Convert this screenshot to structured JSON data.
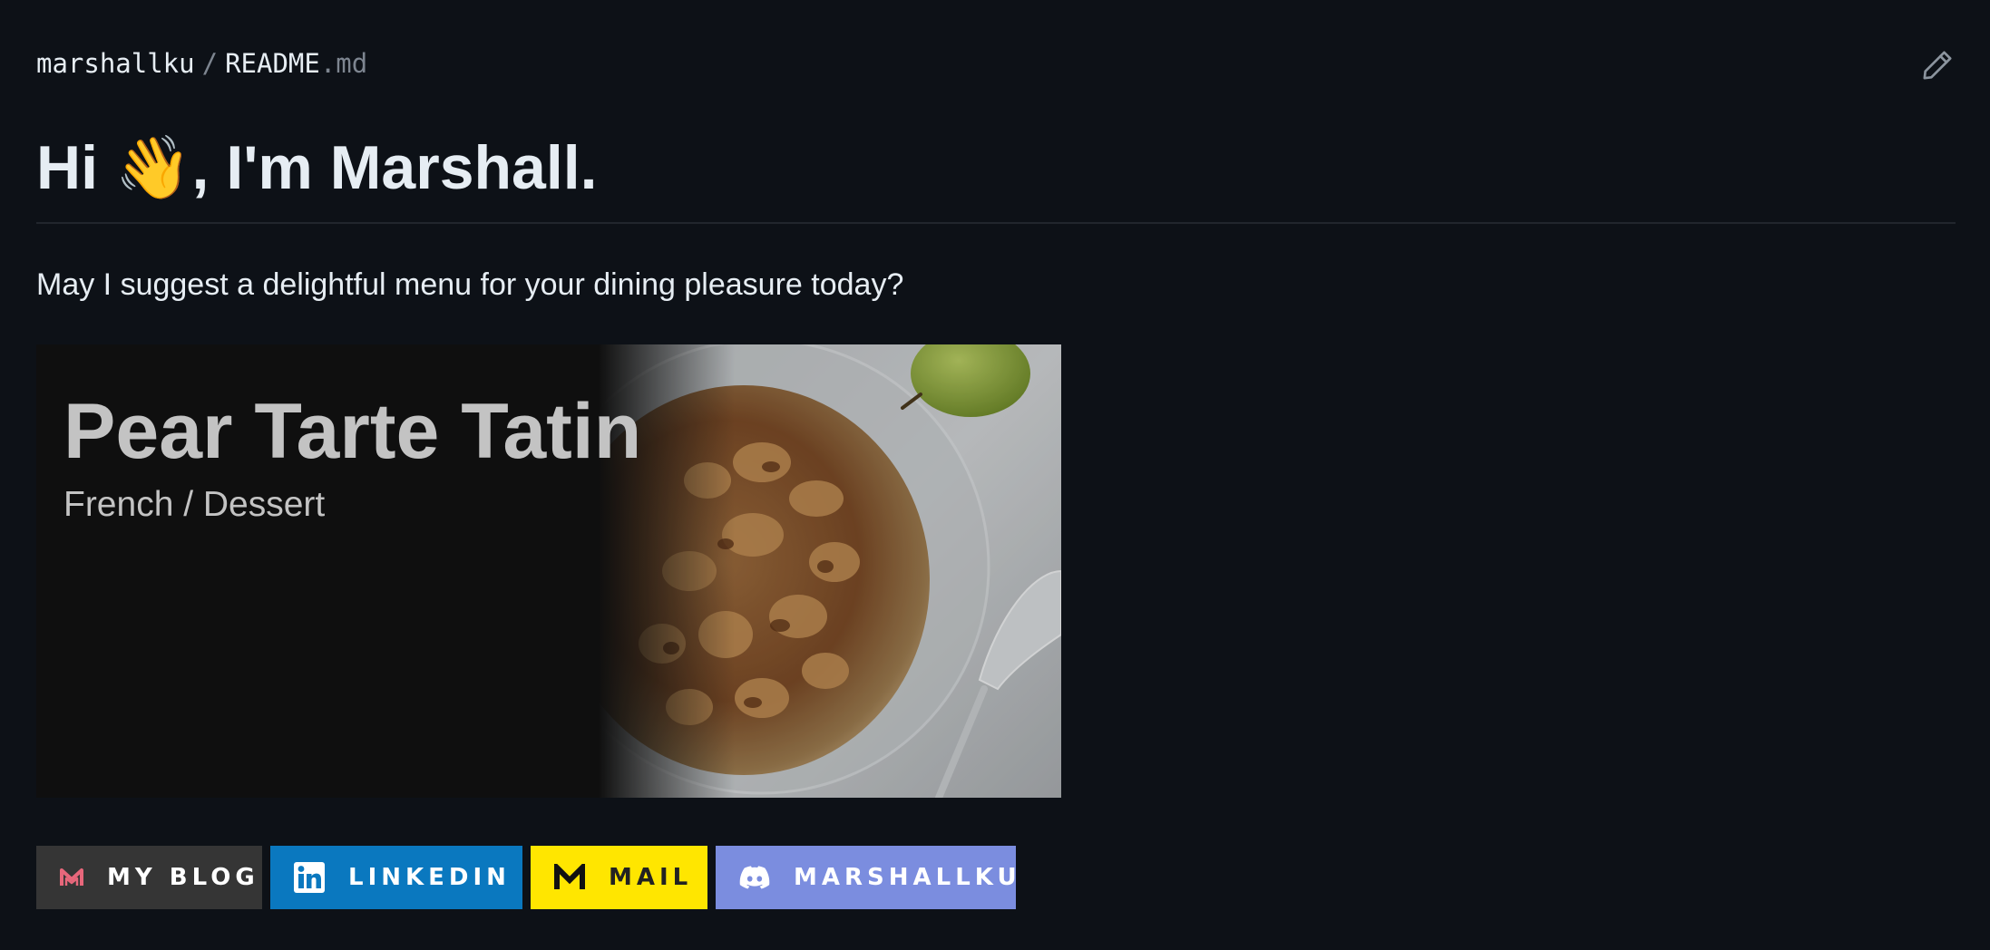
{
  "header": {
    "repo_owner": "marshallku",
    "separator": "/",
    "file_name": "README",
    "file_ext": ".md"
  },
  "readme": {
    "heading": "Hi 👋, I'm Marshall.",
    "intro": "May I suggest a delightful menu for your dining pleasure today?"
  },
  "recipe_card": {
    "title": "Pear Tarte Tatin",
    "subtitle": "French / Dessert"
  },
  "badges": [
    {
      "label": "MY BLOG",
      "icon": "blog-logo-icon",
      "color": "#353535"
    },
    {
      "label": "LINKEDIN",
      "icon": "linkedin-icon",
      "color": "#0a78bf"
    },
    {
      "label": "MAIL",
      "icon": "mail-m-icon",
      "color": "#ffe600"
    },
    {
      "label": "MARSHALLKU",
      "icon": "discord-icon",
      "color": "#7b8ddf"
    }
  ],
  "colors": {
    "background": "#0d1117",
    "text": "#e6edf3",
    "muted": "#7d8590"
  }
}
